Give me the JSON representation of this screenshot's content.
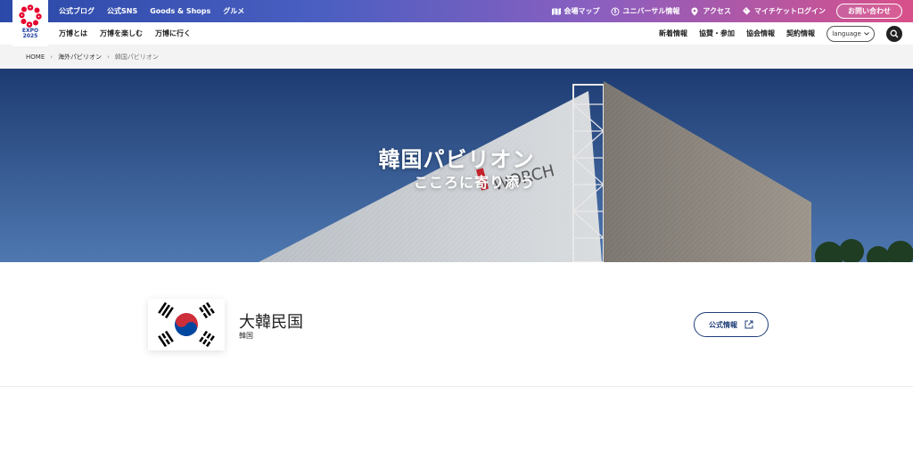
{
  "logo": {
    "text_line1": "EXPO",
    "text_line2": "2025"
  },
  "topbar": {
    "left_links": [
      "公式ブログ",
      "公式SNS",
      "Goods & Shops",
      "グルメ"
    ],
    "right_links": [
      {
        "label": "会場マップ",
        "icon": "map-icon"
      },
      {
        "label": "ユニバーサル情報",
        "icon": "universal-icon"
      },
      {
        "label": "アクセス",
        "icon": "location-pin-icon"
      },
      {
        "label": "マイチケットログイン",
        "icon": "ticket-icon"
      }
    ],
    "contact_label": "お問い合わせ",
    "colors": {
      "gradient_start": "#2b49a8",
      "gradient_end": "#d8508a"
    }
  },
  "subnav": {
    "left_links": [
      "万博とは",
      "万博を楽しむ",
      "万博に行く"
    ],
    "right_links": [
      "新着情報",
      "協賛・参加",
      "協会情報",
      "契約情報"
    ],
    "language_label": "language",
    "search_icon": "search-icon"
  },
  "breadcrumb": {
    "items": [
      "HOME",
      "海外パビリオン",
      "韓国パビリオン"
    ]
  },
  "hero": {
    "title": "韓国パビリオン",
    "subtitle": "こころに寄り添う"
  },
  "country": {
    "name": "大韓民国",
    "short_name": "韓国",
    "official_button_label": "公式情報",
    "flag_icon": "korea-flag-icon",
    "external_link_icon": "external-link-icon",
    "accent_color": "#1f3f78"
  }
}
